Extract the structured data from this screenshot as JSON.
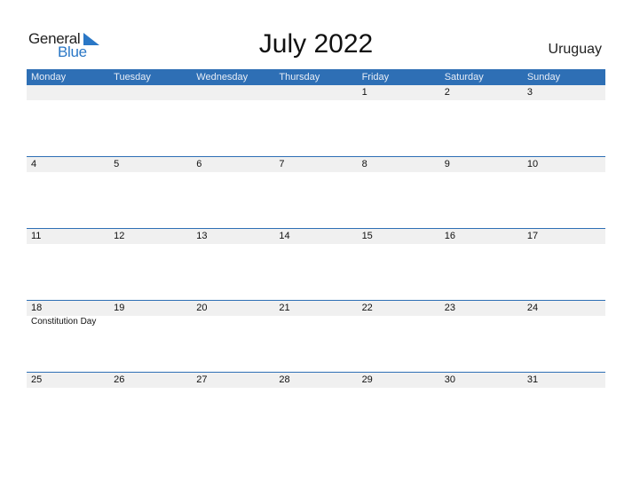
{
  "logo": {
    "general": "General",
    "blue": "Blue"
  },
  "title": "July 2022",
  "country": "Uruguay",
  "weekdays": [
    "Monday",
    "Tuesday",
    "Wednesday",
    "Thursday",
    "Friday",
    "Saturday",
    "Sunday"
  ],
  "weeks": [
    {
      "days": [
        "",
        "",
        "",
        "",
        "1",
        "2",
        "3"
      ],
      "notes": [
        "",
        "",
        "",
        "",
        "",
        "",
        ""
      ]
    },
    {
      "days": [
        "4",
        "5",
        "6",
        "7",
        "8",
        "9",
        "10"
      ],
      "notes": [
        "",
        "",
        "",
        "",
        "",
        "",
        ""
      ]
    },
    {
      "days": [
        "11",
        "12",
        "13",
        "14",
        "15",
        "16",
        "17"
      ],
      "notes": [
        "",
        "",
        "",
        "",
        "",
        "",
        ""
      ]
    },
    {
      "days": [
        "18",
        "19",
        "20",
        "21",
        "22",
        "23",
        "24"
      ],
      "notes": [
        "Constitution Day",
        "",
        "",
        "",
        "",
        "",
        ""
      ]
    },
    {
      "days": [
        "25",
        "26",
        "27",
        "28",
        "29",
        "30",
        "31"
      ],
      "notes": [
        "",
        "",
        "",
        "",
        "",
        "",
        ""
      ]
    }
  ],
  "colors": {
    "accent": "#2e6fb5",
    "logo_blue": "#2a77c6",
    "date_bar": "#f0f0f0"
  }
}
